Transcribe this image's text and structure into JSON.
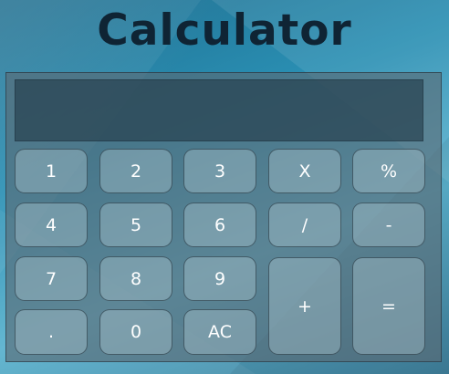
{
  "app": {
    "title": "Calculator"
  },
  "display": {
    "value": ""
  },
  "keys": {
    "k1": "1",
    "k2": "2",
    "k3": "3",
    "multiply": "X",
    "percent": "%",
    "k4": "4",
    "k5": "5",
    "k6": "6",
    "divide": "/",
    "minus": "-",
    "k7": "7",
    "k8": "8",
    "k9": "9",
    "plus": "+",
    "equals": "=",
    "dot": ".",
    "k0": "0",
    "clear": "AC"
  },
  "colors": {
    "title": "#0f2434",
    "key_text": "#ffffff"
  }
}
